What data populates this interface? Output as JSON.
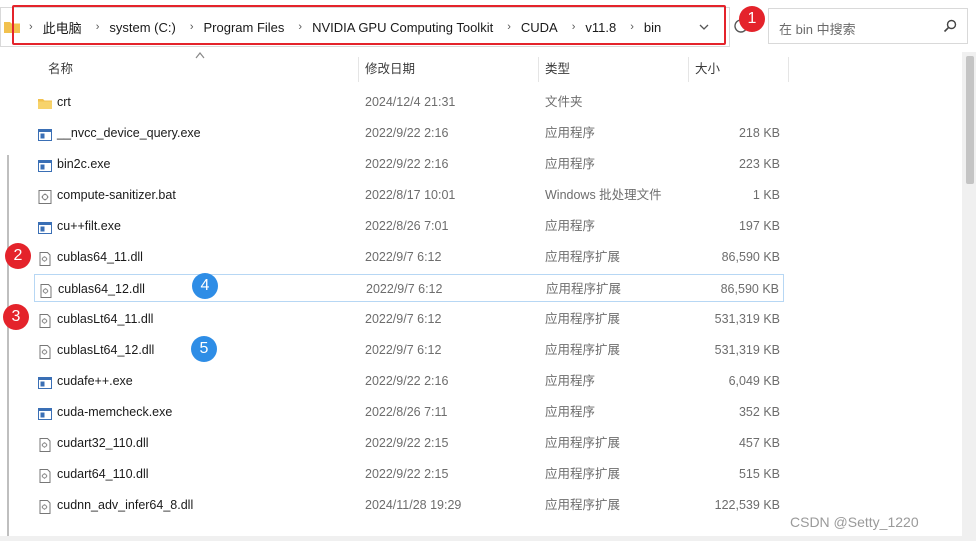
{
  "address": {
    "crumbs": [
      "此电脑",
      "system (C:)",
      "Program Files",
      "NVIDIA GPU Computing Toolkit",
      "CUDA",
      "v11.8",
      "bin"
    ]
  },
  "search": {
    "placeholder": "在 bin 中搜索"
  },
  "columns": {
    "name": "名称",
    "date": "修改日期",
    "type": "类型",
    "size": "大小"
  },
  "files": [
    {
      "icon": "folder-icon",
      "name": "crt",
      "date": "2024/12/4 21:31",
      "type": "文件夹",
      "size": ""
    },
    {
      "icon": "exe-icon",
      "name": "__nvcc_device_query.exe",
      "date": "2022/9/22 2:16",
      "type": "应用程序",
      "size": "218 KB"
    },
    {
      "icon": "exe-icon",
      "name": "bin2c.exe",
      "date": "2022/9/22 2:16",
      "type": "应用程序",
      "size": "223 KB"
    },
    {
      "icon": "bat-icon",
      "name": "compute-sanitizer.bat",
      "date": "2022/8/17 10:01",
      "type": "Windows 批处理文件",
      "size": "1 KB"
    },
    {
      "icon": "exe-icon",
      "name": "cu++filt.exe",
      "date": "2022/8/26 7:01",
      "type": "应用程序",
      "size": "197 KB"
    },
    {
      "icon": "dll-icon",
      "name": "cublas64_11.dll",
      "date": "2022/9/7 6:12",
      "type": "应用程序扩展",
      "size": "86,590 KB"
    },
    {
      "icon": "dll-icon",
      "name": "cublas64_12.dll",
      "date": "2022/9/7 6:12",
      "type": "应用程序扩展",
      "size": "86,590 KB"
    },
    {
      "icon": "dll-icon",
      "name": "cublasLt64_11.dll",
      "date": "2022/9/7 6:12",
      "type": "应用程序扩展",
      "size": "531,319 KB"
    },
    {
      "icon": "dll-icon",
      "name": "cublasLt64_12.dll",
      "date": "2022/9/7 6:12",
      "type": "应用程序扩展",
      "size": "531,319 KB"
    },
    {
      "icon": "exe-icon",
      "name": "cudafe++.exe",
      "date": "2022/9/22 2:16",
      "type": "应用程序",
      "size": "6,049 KB"
    },
    {
      "icon": "exe-icon",
      "name": "cuda-memcheck.exe",
      "date": "2022/8/26 7:11",
      "type": "应用程序",
      "size": "352 KB"
    },
    {
      "icon": "dll-icon",
      "name": "cudart32_110.dll",
      "date": "2022/9/22 2:15",
      "type": "应用程序扩展",
      "size": "457 KB"
    },
    {
      "icon": "dll-icon",
      "name": "cudart64_110.dll",
      "date": "2022/9/22 2:15",
      "type": "应用程序扩展",
      "size": "515 KB"
    },
    {
      "icon": "dll-icon",
      "name": "cudnn_adv_infer64_8.dll",
      "date": "2024/11/28 19:29",
      "type": "应用程序扩展",
      "size": "122,539 KB"
    }
  ],
  "badges": [
    "1",
    "2",
    "3",
    "4",
    "5"
  ],
  "watermark": "CSDN @Setty_1220",
  "colors": {
    "annotation_red": "#e4232b",
    "annotation_blue": "#2e8de6",
    "selection_border": "#b7d7f4",
    "folder": "#f2c14e"
  }
}
